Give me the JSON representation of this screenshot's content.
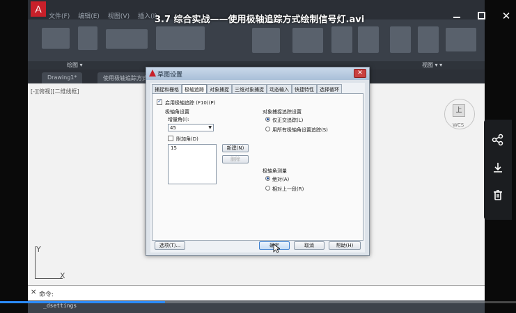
{
  "video": {
    "title": "3.7 综合实战——使用极轴追踪方式绘制信号灯.avi",
    "progress": 0.32
  },
  "window_controls": {
    "minimize": "minimize",
    "maximize": "maximize",
    "close": "✕"
  },
  "side_panel": {
    "share_icon": "share-icon",
    "download_icon": "download-icon",
    "delete_icon": "trash-icon"
  },
  "cad": {
    "menubar": [
      "文件(F)",
      "编辑(E)",
      "视图(V)",
      "插入(I)"
    ],
    "ribbon_footer": {
      "left": "绘图 ▾",
      "right": "视图 ▾ ▾"
    },
    "tabs": [
      "Drawing1*",
      "使用极轴追踪方式绘*"
    ],
    "canvas_label": "[-][俯视][二维线框]",
    "viewcube_face": "上",
    "wcs": "WCS",
    "ucs_x": "X",
    "ucs_y": "Y",
    "command_label": "命令:",
    "command_line": "_dsettings"
  },
  "dialog": {
    "title": "草图设置",
    "tabs": [
      "捕捉和栅格",
      "极轴追踪",
      "对象捕捉",
      "三维对象捕捉",
      "动态输入",
      "快捷特性",
      "选择循环"
    ],
    "active_tab": 1,
    "polar_on_label": "启用极轴追踪 (F10)(P)",
    "polar_on": true,
    "angle_settings_title": "极轴角设置",
    "increment_label": "增量角(I):",
    "increment_value": "45",
    "additional_label": "附加角(D)",
    "additional_checked": false,
    "additional_list": [
      "15"
    ],
    "new_button": "新建(N)",
    "delete_button": "删除",
    "snap_tracking_title": "对象捕捉追踪设置",
    "orthogonal_only": "仅正交追踪(L)",
    "all_polar": "用所有极轴角设置追踪(S)",
    "measurement_title": "极轴角测量",
    "absolute": "绝对(A)",
    "relative": "相对上一段(R)",
    "options_button": "选项(T)...",
    "ok_button": "确定",
    "cancel_button": "取消",
    "help_button": "帮助(H)"
  }
}
